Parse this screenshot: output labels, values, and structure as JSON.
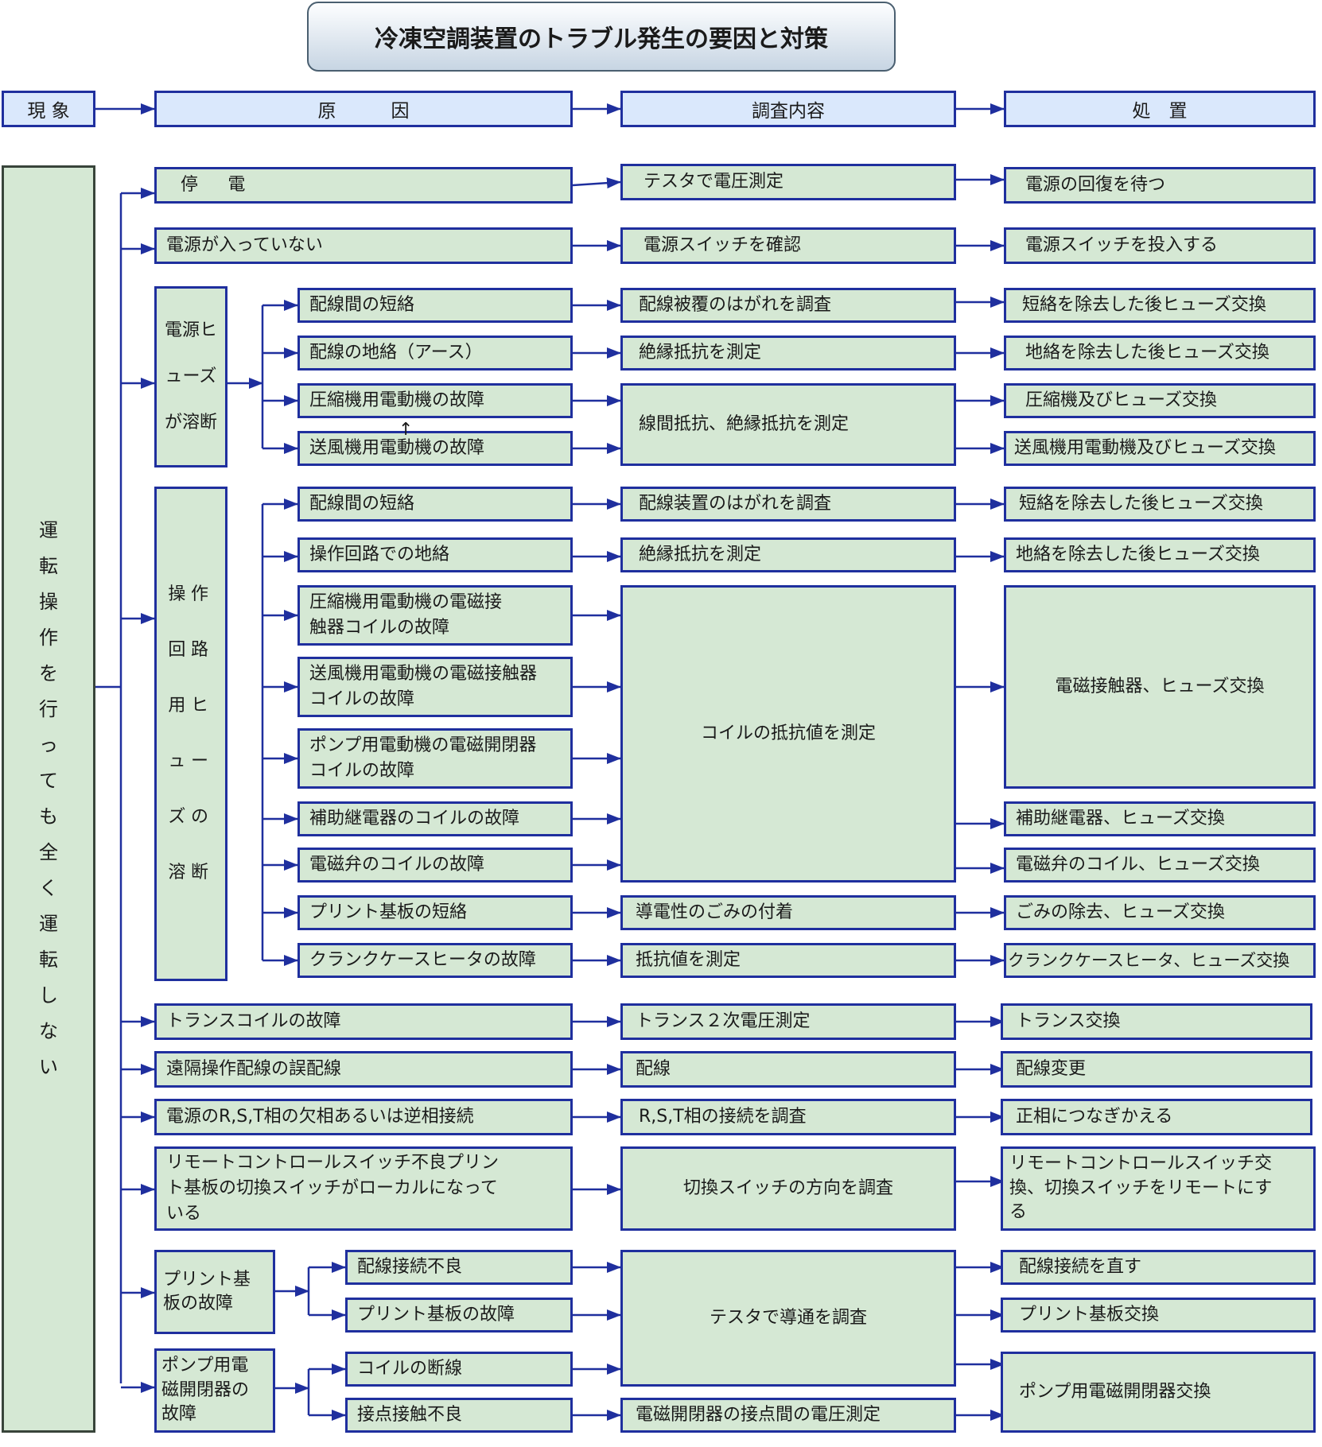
{
  "title": "冷凍空調装置のトラブル発生の要因と対策",
  "headers": {
    "phenomenon": "現 象",
    "cause": "原　　　因",
    "investigation": "調査内容",
    "action": "処　置"
  },
  "phenomenon_chars": [
    "運",
    "転",
    "操",
    "作",
    "を",
    "行",
    "っ",
    "て",
    "も",
    "全",
    "く",
    "運",
    "転",
    "し",
    "な",
    "い"
  ],
  "causes": {
    "outage": "停　電",
    "no_power": "電源が入っていない",
    "main_fuse": "電源ヒ\nューズ\nが溶断",
    "main_fuse_sub": [
      "配線間の短絡",
      "配線の地絡（アース）",
      "圧縮機用電動機の故障",
      "送風機用電動機の故障"
    ],
    "op_fuse": "操作\n回路\n用ヒ\nュー\nズの\n溶断",
    "op_fuse_sub": [
      "配線間の短絡",
      "操作回路での地絡",
      "圧縮機用電動機の電磁接\n触器コイルの故障",
      "送風機用電動機の電磁接触器\nコイルの故障",
      "ポンプ用電動機の電磁開閉器\nコイルの故障",
      "補助継電器のコイルの故障",
      "電磁弁のコイルの故障",
      "プリント基板の短絡",
      "クランクケースヒータの故障"
    ],
    "trans_coil": "トランスコイルの故障",
    "remote_wiring": "遠隔操作配線の誤配線",
    "phase": "電源のR,S,T相の欠相あるいは逆相接続",
    "remote_switch": "リモートコントロールスイッチ不良プリン\nト基板の切換スイッチがローカルになって\nいる",
    "pcb": "プリント基\n板の故障",
    "pcb_sub": [
      "配線接続不良",
      "プリント基板の故障"
    ],
    "pump_switch": "ポンプ用電\n磁開閉器の\n故障",
    "pump_sub": [
      "コイルの断線",
      "接点接触不良"
    ]
  },
  "investigations": {
    "voltage": "テスタで電圧測定",
    "power_switch": "電源スイッチを確認",
    "coating": "配線被覆のはがれを調査",
    "insulation1": "絶縁抵抗を測定",
    "line_res": "線間抵抗、絶縁抵抗を測定",
    "device": "配線装置のはがれを調査",
    "insulation2": "絶縁抵抗を測定",
    "coil_res": "コイルの抵抗値を測定",
    "dust": "導電性のごみの付着",
    "resistance": "抵抗値を測定",
    "trans_voltage": "トランス２次電圧測定",
    "wiring": "配線",
    "rst": "R,S,T相の接続を調査",
    "switch_dir": "切換スイッチの方向を調査",
    "continuity": "テスタで導通を調査",
    "contact_voltage": "電磁開閉器の接点間の電圧測定"
  },
  "actions": {
    "wait": "電源の回復を待つ",
    "turn_on": "電源スイッチを投入する",
    "a_short": "短絡を除去した後ヒューズ交換",
    "a_ground": "地絡を除去した後ヒューズ交換",
    "a_comp": "圧縮機及びヒューズ交換",
    "a_fan": "送風機用電動機及びヒューズ交換",
    "b_short": "短絡を除去した後ヒューズ交換",
    "b_ground": "地絡を除去した後ヒューズ交換",
    "contactor": "電磁接触器、ヒューズ交換",
    "relay": "補助継電器、ヒューズ交換",
    "valve": "電磁弁のコイル、ヒューズ交換",
    "dust": "ごみの除去、ヒューズ交換",
    "crank": "クランクケースヒータ、ヒューズ交換",
    "trans": "トランス交換",
    "rewire": "配線変更",
    "phase": "正相につなぎかえる",
    "remote": "リモートコントロールスイッチ交\n換、切換スイッチをリモートにす\nる",
    "wiring_fix": "配線接続を直す",
    "pcb": "プリント基板交換",
    "pump": "ポンプ用電磁開閉器交換"
  },
  "colors": {
    "box_fill": "#d5e8d4",
    "header_fill": "#dae8fc",
    "border": "#1f2f9e"
  }
}
